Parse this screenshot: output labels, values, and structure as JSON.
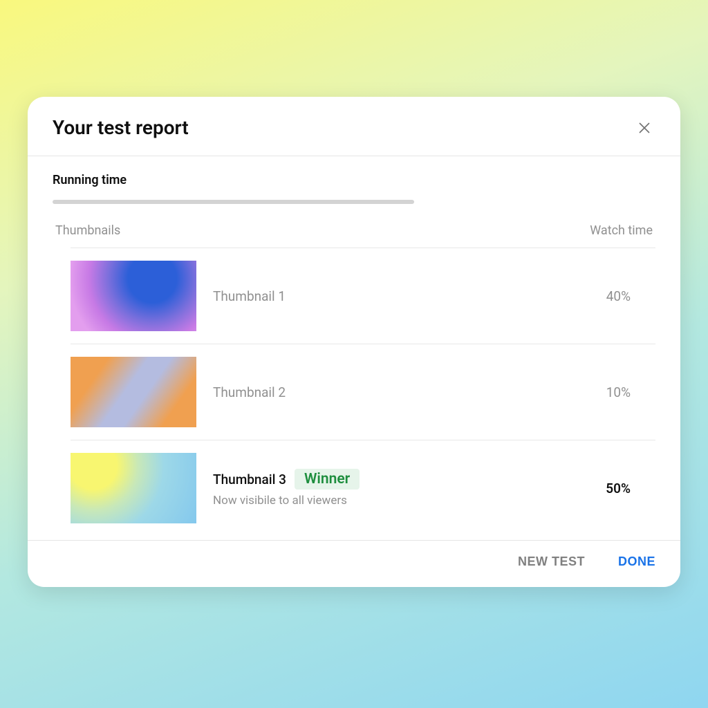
{
  "dialog": {
    "title": "Your test report",
    "running_time_label": "Running time",
    "columns": {
      "thumbnails": "Thumbnails",
      "watch_time": "Watch time"
    },
    "rows": [
      {
        "label": "Thumbnail 1",
        "value": "40%",
        "winner": false,
        "subtext": ""
      },
      {
        "label": "Thumbnail 2",
        "value": "10%",
        "winner": false,
        "subtext": ""
      },
      {
        "label": "Thumbnail 3",
        "value": "50%",
        "winner": true,
        "winner_badge": "Winner",
        "subtext": "Now visibile to all viewers"
      }
    ],
    "footer": {
      "new_test": "NEW TEST",
      "done": "DONE"
    }
  }
}
